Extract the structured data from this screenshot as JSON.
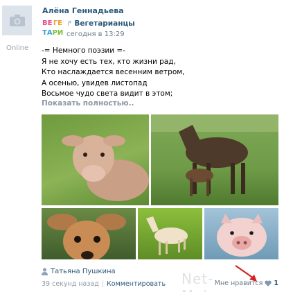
{
  "post": {
    "author": "Алёна Геннадьева",
    "status": "Online",
    "group_logo_letters": [
      "ВЕ",
      "ГЕ",
      "ТА",
      "РИ"
    ],
    "group_name": "Вегетарианцы",
    "repost_icon": "repost-arrow-icon",
    "time": "сегодня в 13:29",
    "text_lines": [
      "-= Немного поэзии =-",
      "Я не хочу есть тех, кто жизни рад,",
      "Кто наслаждается весенним ветром,",
      "А осенью, увидев листопад",
      "Восьмое чудо света видит в этом;"
    ],
    "show_more": "Показать полностью.."
  },
  "photos": [
    {
      "subject": "calf"
    },
    {
      "subject": "moose-with-calf"
    },
    {
      "subject": "fawn"
    },
    {
      "subject": "foal"
    },
    {
      "subject": "piglet"
    }
  ],
  "footer": {
    "liker_icon": "person-icon",
    "liker_name": "Татьяна Пушкина",
    "time": "39 секунд назад",
    "separator": "|",
    "comment": "Комментировать",
    "like_label": "Мне нравится",
    "like_icon": "heart-icon",
    "like_count": "1"
  },
  "watermark": "Net-Mata.com",
  "colors": {
    "link": "#2b587a",
    "muted": "#8b98a6",
    "arrow": "#d32222"
  }
}
